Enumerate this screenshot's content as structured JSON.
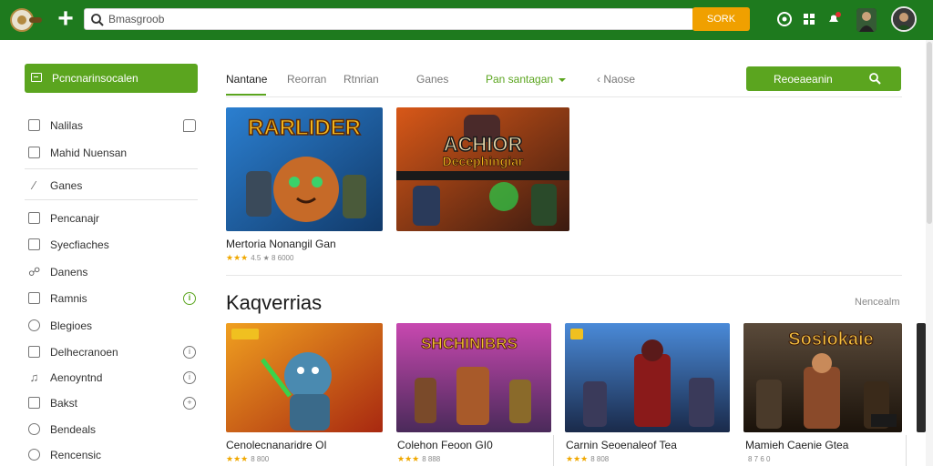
{
  "colors": {
    "topbar": "#1e7a1e",
    "accent_green": "#5ba51f",
    "search_button": "#f0a000",
    "star": "#f0a800"
  },
  "topbar": {
    "logo_icon": "controller-logo-icon",
    "plus_icon": "plus-icon",
    "search_value": "Bmasgroob",
    "search_button_label": "SORK",
    "icons": [
      "game-pad-icon",
      "puzzle-icon",
      "notification-icon"
    ],
    "notification_badge": "•"
  },
  "sidebar": {
    "create_button_label": "Pcncnarinsocalen",
    "items": [
      {
        "label": "Nalilas",
        "icon": "folder-icon",
        "right": "chat-icon"
      },
      {
        "label": "Mahid Nuensan",
        "icon": "inbox-icon",
        "right": ""
      },
      {
        "label": "Ganes",
        "icon": "slash-icon",
        "right": ""
      },
      {
        "label": "Pencanajr",
        "icon": "bookmark-icon",
        "right": ""
      },
      {
        "label": "Syecfiaches",
        "icon": "grid-icon",
        "right": ""
      },
      {
        "label": "Danens",
        "icon": "people-icon",
        "right": ""
      },
      {
        "label": "Ramnis",
        "icon": "square-icon",
        "right": "info-icon-green"
      },
      {
        "label": "Blegioes",
        "icon": "clock-icon",
        "right": ""
      },
      {
        "label": "Delhecranoen",
        "icon": "chat-icon",
        "right": "info-icon"
      },
      {
        "label": "Aenoyntnd",
        "icon": "music-icon",
        "right": "info-icon"
      },
      {
        "label": "Bakst",
        "icon": "box-icon",
        "right": "plus-circle-icon"
      },
      {
        "label": "Bendeals",
        "icon": "tag-icon",
        "right": ""
      },
      {
        "label": "Rencensic",
        "icon": "speech-icon",
        "right": ""
      }
    ]
  },
  "tabs": [
    {
      "label": "Nantane"
    },
    {
      "label": "Reorran"
    },
    {
      "label": "Rtnrian"
    },
    {
      "label": "Ganes"
    },
    {
      "label": "Pan santagan"
    },
    {
      "label": "Naose"
    }
  ],
  "action_button_label": "Reoeaeanin",
  "featured": [
    {
      "art_text": "RARLIDER",
      "title": "Mertoria Nonangil Gan",
      "rating": "4.5 ★ 8 6000"
    },
    {
      "art_text": "ACHIOR",
      "art_sub": "Decephingiar",
      "title": "",
      "rating": ""
    }
  ],
  "section": {
    "title": "Kaqverrias",
    "more": "Nencealm"
  },
  "cards": [
    {
      "art_text": "",
      "title": "Cenolecnanaridre OI",
      "rating": "8 800"
    },
    {
      "art_text": "SHCHINIBRS",
      "title": "Colehon Feoon GI0",
      "rating": "8 888"
    },
    {
      "art_text": "",
      "title": "Carnin Seoenaleof Tea",
      "rating": "8 808"
    },
    {
      "art_text": "Sosiokaie",
      "title": "Mamieh Caenie Gtea",
      "rating": "8 7 6 0"
    }
  ],
  "star_glyphs": "★★★"
}
